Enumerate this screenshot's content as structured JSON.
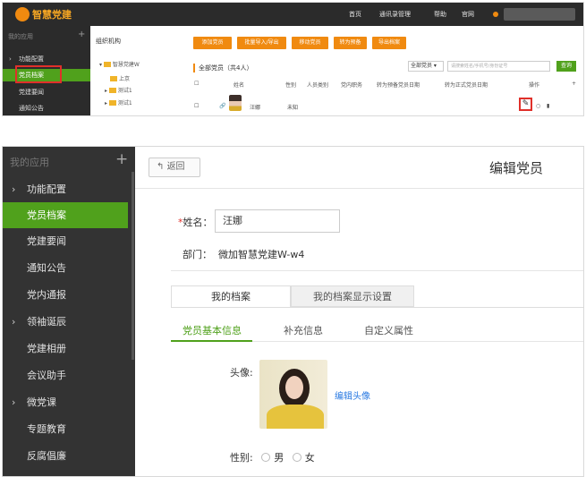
{
  "top": {
    "logo_text": "智慧党建",
    "nav": [
      "首页",
      "通讯录管理",
      "帮助",
      "官网"
    ],
    "sidebar_head": "我的应用",
    "sidebar_items": [
      "功能配置",
      "党员档案",
      "党建要闻",
      "通知公告"
    ],
    "tree_head": "组织机构",
    "tree_items": [
      "智慧党建W",
      "上京",
      "测试1",
      "测试1"
    ],
    "buttons": [
      "添加党员",
      "批量导入/导出",
      "移动党员",
      "转为预备",
      "导出档案"
    ],
    "count_label": "全部党员（共4人）",
    "filter_value": "全部党员",
    "search_placeholder": "请搜索姓名/手机号/身份证号",
    "search_label": "查询",
    "columns": [
      "姓名",
      "性别",
      "人员类别",
      "党内职务",
      "转为预备党员日期",
      "转为正式党员日期",
      "操作"
    ],
    "row": {
      "name": "汪娜",
      "gender": "未知"
    }
  },
  "bottom": {
    "sidebar_head": "我的应用",
    "sidebar_items": [
      "功能配置",
      "党员档案",
      "党建要闻",
      "通知公告",
      "党内通报",
      "领袖诞辰",
      "党建相册",
      "会议助手",
      "微党课",
      "专题教育",
      "反腐倡廉"
    ],
    "back_label": "返回",
    "page_title": "编辑党员",
    "name_label": "姓名：",
    "name_value": "汪娜",
    "dept_label": "部门：",
    "dept_value": "微加智慧党建W-w4",
    "tabs": [
      "我的档案",
      "我的档案显示设置"
    ],
    "subtabs": [
      "党员基本信息",
      "补充信息",
      "自定义属性"
    ],
    "avatar_label": "头像:",
    "edit_avatar": "编辑头像",
    "gender_label": "性别:",
    "gender_options": [
      "男",
      "女"
    ]
  }
}
